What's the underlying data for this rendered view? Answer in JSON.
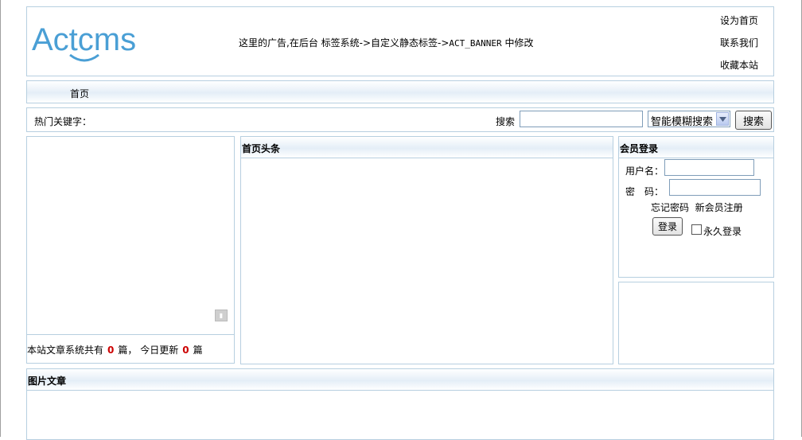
{
  "header": {
    "logo_text": "Actcms",
    "banner_prefix": "这里的广告,在后台 标签系统->自定义静态标签->",
    "banner_code": "ACT_BANNER",
    "banner_suffix": " 中修改",
    "links": [
      "设为首页",
      "联系我们",
      "收藏本站"
    ]
  },
  "nav": {
    "items": [
      "首页"
    ]
  },
  "search": {
    "hot_keywords_label": "热门关键字：",
    "label": "搜索",
    "input_value": "",
    "select_value": "智能模糊搜索",
    "button_label": "搜索"
  },
  "left": {
    "stats_prefix": "本站文章系统共有",
    "total_count": "0",
    "stats_mid": "篇， 今日更新",
    "today_count": "0",
    "stats_suffix": "篇"
  },
  "center": {
    "title": "首页头条"
  },
  "login": {
    "title": "会员登录",
    "username_label": "用户名：",
    "password_label": "密　码：",
    "forgot_link": "忘记密码",
    "register_link": "新会员注册",
    "login_button": "登录",
    "remember_label": "永久登录"
  },
  "bottom": {
    "title": "图片文章"
  },
  "colors": {
    "border": "#b7cfe0",
    "logo_blue": "#4a9fd5",
    "count_red": "#cc0000"
  }
}
